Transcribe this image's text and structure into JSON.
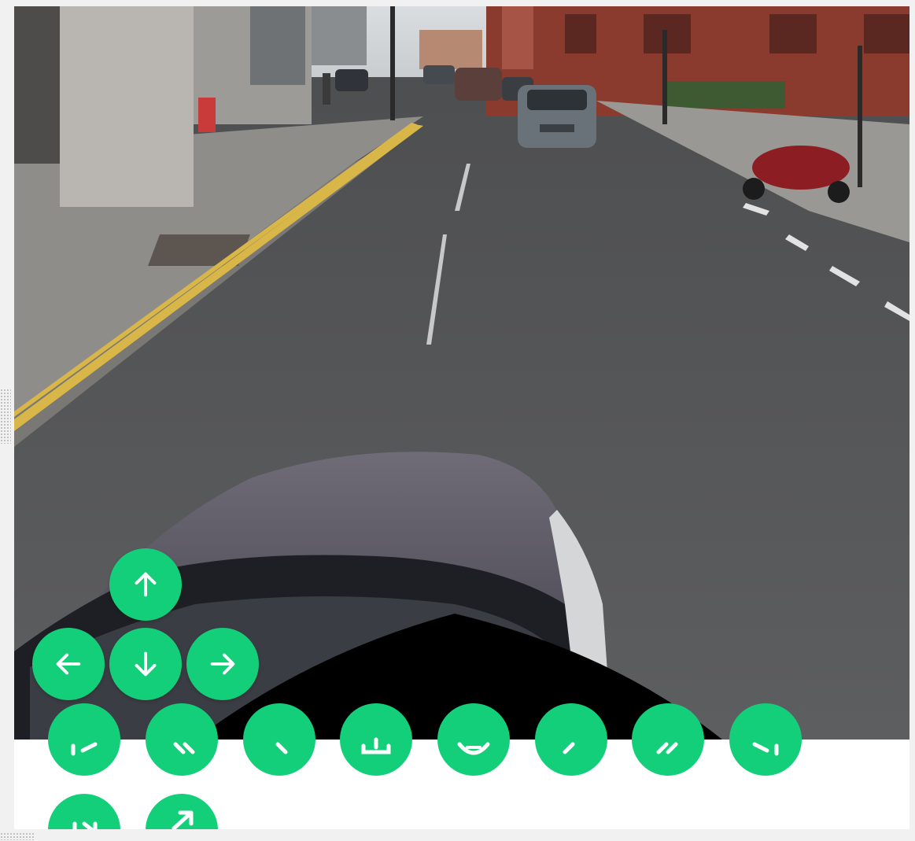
{
  "viewer": {
    "description_none": ""
  },
  "nav_controls": {
    "up": {
      "icon": "arrow-up-icon"
    },
    "left": {
      "icon": "arrow-left-icon"
    },
    "down": {
      "icon": "arrow-down-icon"
    },
    "right": {
      "icon": "arrow-right-icon"
    }
  },
  "toolbar": {
    "row1": [
      "skip-to-start-icon",
      "rewind-icon",
      "previous-icon",
      "download-icon",
      "center-view-icon",
      "next-icon",
      "fast-forward-icon",
      "skip-to-end-icon"
    ],
    "row2": [
      "skip-next-icon",
      "open-external-icon"
    ]
  },
  "colors": {
    "accent": "#14cf7a",
    "icon": "#ffffff",
    "background": "#f1f1f1",
    "panel": "#ffffff"
  }
}
